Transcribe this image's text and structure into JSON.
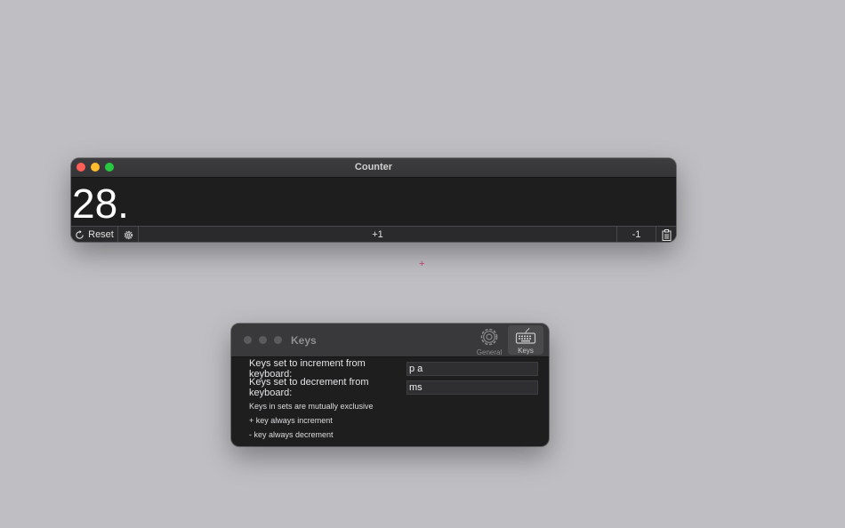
{
  "counter_window": {
    "title": "Counter",
    "count": "28.",
    "toolbar": {
      "reset_label": "Reset",
      "increment_label": "+1",
      "decrement_label": "-1"
    }
  },
  "cursor_glyph": "+",
  "keys_window": {
    "title": "Keys",
    "tabs": [
      {
        "label": "General",
        "icon": "gear-icon"
      },
      {
        "label": "Keys",
        "icon": "keyboard-icon"
      }
    ],
    "increment_keys": {
      "label": "Keys set to increment from keyboard:",
      "value": "p a"
    },
    "decrement_keys": {
      "label": "Keys set to decrement from keyboard:",
      "value": "ms"
    },
    "notes": [
      "Keys in sets are mutually exclusive",
      "+ key always increment",
      "- key always decrement"
    ]
  },
  "colors": {
    "desktop": "#bfbfc3",
    "close": "#ff5f57",
    "minimize": "#febc2e",
    "zoom": "#28c840"
  }
}
